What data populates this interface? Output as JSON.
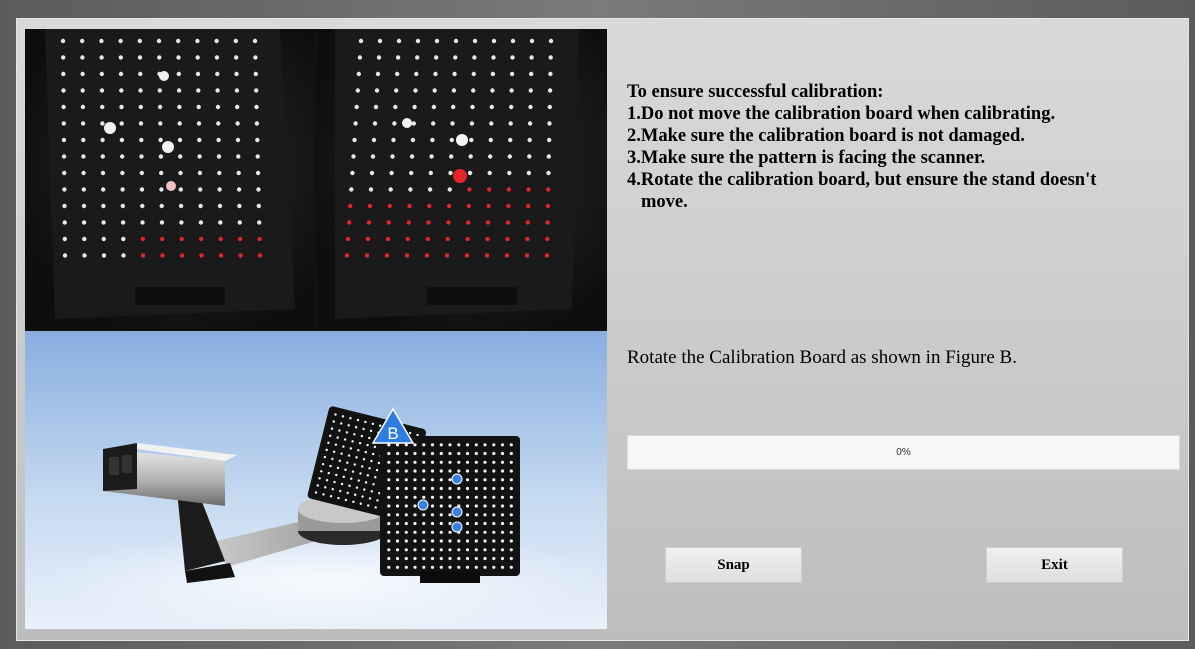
{
  "instructions": {
    "heading": "To ensure successful calibration:",
    "items": [
      "1.Do not move the calibration board when calibrating.",
      "2.Make sure the calibration board is not damaged.",
      "3.Make sure the pattern is facing the scanner.",
      "4.Rotate the calibration board, but ensure the stand doesn't",
      "move."
    ]
  },
  "rotate_prompt": "Rotate the Calibration Board as shown in Figure B.",
  "progress": {
    "value": 0,
    "label": "0%"
  },
  "buttons": {
    "snap": "Snap",
    "exit": "Exit"
  },
  "figure": {
    "board_label": "B"
  },
  "colors": {
    "detected_dot": "#e0262a",
    "marker_blue": "#3b7fe0",
    "badge_blue": "#2f7de1"
  }
}
